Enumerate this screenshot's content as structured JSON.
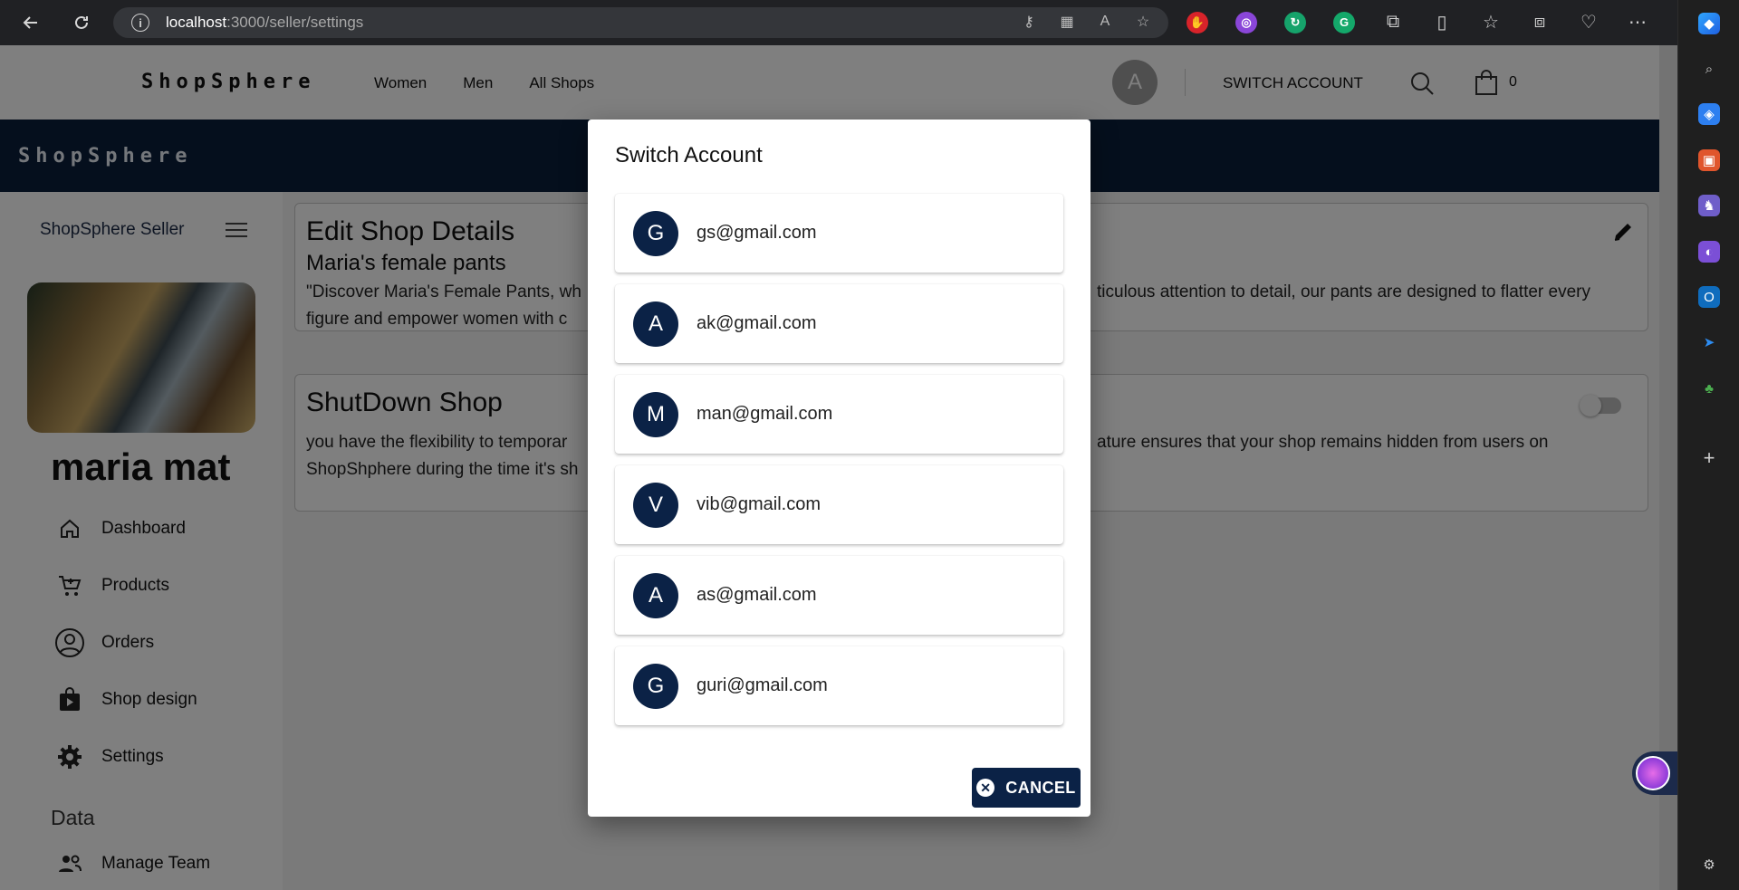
{
  "browser": {
    "url_host": "localhost",
    "url_path": ":3000/seller/settings"
  },
  "header": {
    "brand": "ShopSphere",
    "nav": [
      "Women",
      "Men",
      "All Shops"
    ],
    "avatar_initial": "A",
    "switch_account": "SWITCH ACCOUNT",
    "cart_count": "0"
  },
  "banner": {
    "title": "ShopSphere"
  },
  "sidebar": {
    "title": "ShopSphere Seller",
    "user_name": "maria mat",
    "items": [
      {
        "label": "Dashboard",
        "icon": "home-icon"
      },
      {
        "label": "Products",
        "icon": "cart-icon"
      },
      {
        "label": "Orders",
        "icon": "user-circle-icon"
      },
      {
        "label": "Shop design",
        "icon": "play-bag-icon"
      },
      {
        "label": "Settings",
        "icon": "gear-icon"
      }
    ],
    "section_label": "Data",
    "team_label": "Manage Team"
  },
  "cards": {
    "edit": {
      "title": "Edit Shop Details",
      "shop_name": "Maria's female pants",
      "description_left": "\"Discover Maria's Female Pants, wh",
      "description_right": "ticulous attention to detail, our pants are designed to flatter every",
      "description_line2": "figure and empower women with c"
    },
    "shutdown": {
      "title": "ShutDown Shop",
      "line1_left": "you have the flexibility to temporar",
      "line1_right": "ature ensures that your shop remains hidden from users on",
      "line2": "ShopShphere during the time it's sh"
    }
  },
  "modal": {
    "title": "Switch Account",
    "accounts": [
      {
        "initial": "G",
        "email": "gs@gmail.com"
      },
      {
        "initial": "A",
        "email": "ak@gmail.com"
      },
      {
        "initial": "M",
        "email": "man@gmail.com"
      },
      {
        "initial": "V",
        "email": "vib@gmail.com"
      },
      {
        "initial": "A",
        "email": "as@gmail.com"
      },
      {
        "initial": "G",
        "email": "guri@gmail.com"
      }
    ],
    "cancel_label": "CANCEL"
  },
  "colors": {
    "navy": "#0b2246",
    "banner": "#0b1e3b"
  }
}
